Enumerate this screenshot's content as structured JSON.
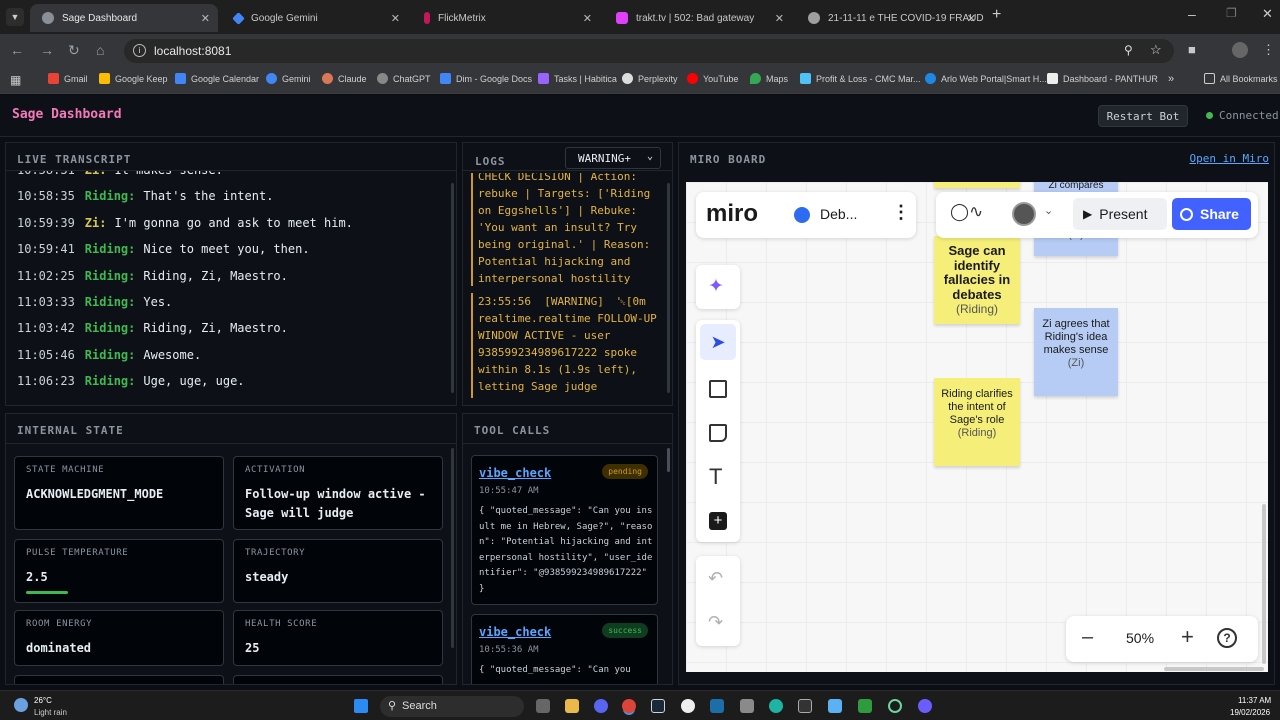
{
  "browser": {
    "tabs": [
      {
        "title": "Sage Dashboard",
        "color": "#5f6368",
        "active": true
      },
      {
        "title": "Google Gemini",
        "color": "#4285f4"
      },
      {
        "title": "FlickMetrix",
        "color": "#c2185b"
      },
      {
        "title": "trakt.tv | 502: Bad gateway",
        "color": "#e040fb"
      },
      {
        "title": "21-11-11 e THE COVID-19 FRAUD & W",
        "color": "#9e9e9e"
      }
    ],
    "url": "localhost:8081",
    "bookmarks": [
      "Gmail",
      "Google Keep",
      "Google Calendar",
      "Gemini",
      "Claude",
      "ChatGPT",
      "Dim - Google Docs",
      "Tasks | Habitica",
      "Perplexity",
      "YouTube",
      "Maps",
      "Profit & Loss - CMC Mar...",
      "Arlo Web Portal|Smart H...",
      "Dashboard - PANTHUR"
    ],
    "all_bookmarks": "All Bookmarks"
  },
  "app": {
    "title": "Sage Dashboard",
    "restart_label": "Restart Bot",
    "status": "Connected"
  },
  "transcript": {
    "heading": "LIVE TRANSCRIPT",
    "lines": [
      {
        "time": "10:58:31",
        "speaker": "Zi:",
        "text": "It makes sense."
      },
      {
        "time": "10:58:35",
        "speaker": "Riding:",
        "text": "That's the intent."
      },
      {
        "time": "10:59:39",
        "speaker": "Zi:",
        "text": "I'm gonna go and ask to meet him."
      },
      {
        "time": "10:59:41",
        "speaker": "Riding:",
        "text": "Nice to meet you, then."
      },
      {
        "time": "11:02:25",
        "speaker": "Riding:",
        "text": "Riding, Zi, Maestro."
      },
      {
        "time": "11:03:33",
        "speaker": "Riding:",
        "text": "Yes."
      },
      {
        "time": "11:03:42",
        "speaker": "Riding:",
        "text": "Riding, Zi, Maestro."
      },
      {
        "time": "11:05:46",
        "speaker": "Riding:",
        "text": "Awesome."
      },
      {
        "time": "11:06:23",
        "speaker": "Riding:",
        "text": "Uge, uge, uge."
      }
    ]
  },
  "logs": {
    "heading": "LOGS",
    "filter": "WARNING+",
    "entries": [
      "CHECK DECISION | Action: rebuke | Targets: ['Riding on Eggshells'] | Rebuke: 'You want an insult? Try being original.' | Reason: Potential hijacking and interpersonal hostility",
      "23:55:56  [WARNING]  ␛[0m realtime.realtime FOLLOW-UP WINDOW ACTIVE - user 938599234989617222 spoke within 8.1s (1.9s left), letting Sage judge"
    ]
  },
  "state": {
    "heading": "INTERNAL STATE",
    "cards": [
      {
        "label": "STATE MACHINE",
        "value": "ACKNOWLEDGMENT_MODE"
      },
      {
        "label": "ACTIVATION",
        "value": "Follow-up window active - Sage will judge"
      },
      {
        "label": "PULSE TEMPERATURE",
        "value": "2.5"
      },
      {
        "label": "TRAJECTORY",
        "value": "steady"
      },
      {
        "label": "ROOM ENERGY",
        "value": "dominated"
      },
      {
        "label": "HEALTH SCORE",
        "value": "25"
      }
    ],
    "pulse_fraction": 0.22
  },
  "tools": {
    "heading": "TOOL CALLS",
    "calls": [
      {
        "name": "vibe_check",
        "status": "pending",
        "time": "10:55:47 AM",
        "args": "{ \"quoted_message\": \"Can you insult me in Hebrew, Sage?\", \"reason\": \"Potential hijacking and interpersonal hostility\", \"user_identifier\": \"@938599234989617222\" }"
      },
      {
        "name": "vibe_check",
        "status": "success",
        "time": "10:55:36 AM",
        "args": "{ \"quoted_message\": \"Can you"
      }
    ]
  },
  "miro": {
    "heading": "MIRO BOARD",
    "open_link": "Open in Miro",
    "logo": "miro",
    "board_name": "Deb...",
    "present_label": "Present",
    "share_label": "Share",
    "zoom": "50%",
    "stickies": [
      {
        "text": "Zi compares",
        "author": "",
        "color": "#b6ccf5"
      },
      {
        "text": "",
        "author": "(Zi)",
        "color": "#b6ccf5"
      },
      {
        "text": "Sage can identify fallacies in debates",
        "author": "(Riding)",
        "color": "#f5ef7a"
      },
      {
        "text": "Zi agrees that Riding's idea makes sense",
        "author": "(Zi)",
        "color": "#b6ccf5"
      },
      {
        "text": "Riding clarifies the intent of Sage's role",
        "author": "(Riding)",
        "color": "#f5ef7a"
      }
    ]
  },
  "taskbar": {
    "temp": "26°C",
    "weather": "Light rain",
    "search": "Search",
    "time": "11:37 AM",
    "date": "19/02/2026"
  }
}
